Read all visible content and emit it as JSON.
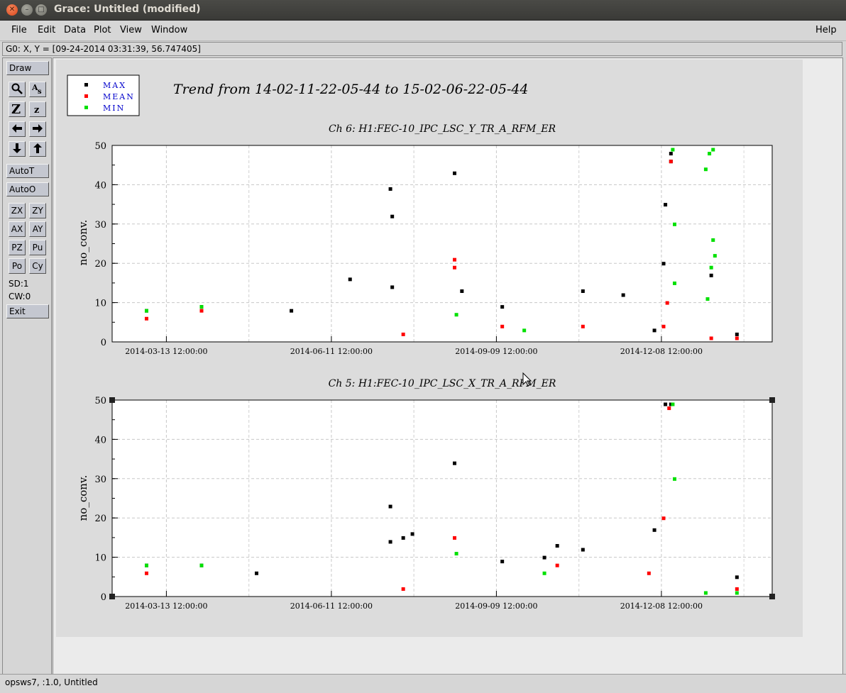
{
  "window": {
    "title": "Grace: Untitled (modified)"
  },
  "menus": {
    "file": "File",
    "edit": "Edit",
    "data": "Data",
    "plot": "Plot",
    "view": "View",
    "window": "Window",
    "help": "Help"
  },
  "locator": "G0: X, Y = [09-24-2014 03:31:39, 56.747405]",
  "toolbar": {
    "draw": "Draw",
    "autot": "AutoT",
    "autoo": "AutoO",
    "zx": "ZX",
    "zy": "ZY",
    "ax": "AX",
    "ay": "AY",
    "pz": "PZ",
    "pu": "Pu",
    "po": "Po",
    "cy": "Cy",
    "sd": "SD:1",
    "cw": "CW:0",
    "exit": "Exit"
  },
  "status": "opsws7, :1.0, Untitled",
  "colors": {
    "max": "#000000",
    "mean": "#ff0000",
    "min": "#00e000",
    "legend_text": "#0000cc"
  },
  "legend": [
    {
      "label": "MAX",
      "color": "#000000"
    },
    {
      "label": "MEAN",
      "color": "#ff0000"
    },
    {
      "label": "MIN",
      "color": "#00e000"
    }
  ],
  "title": "Trend from 14-02-11-22-05-44 to 15-02-06-22-05-44",
  "chart_data": [
    {
      "type": "scatter",
      "title": "Ch 6: H1:FEC-10_IPC_LSC_Y_TR_A_RFM_ER",
      "ylabel": "no_conv.",
      "xlabel": "",
      "xticks": [
        "2014-03-13 12:00:00",
        "2014-06-11 12:00:00",
        "2014-09-09 12:00:00",
        "2014-12-08 12:00:00"
      ],
      "ylim": [
        0,
        50
      ],
      "yticks": [
        0,
        10,
        20,
        30,
        40,
        50
      ],
      "grid": true,
      "series": [
        {
          "name": "MAX",
          "x": [
            "2014-03-02",
            "2014-04-01",
            "2014-05-20",
            "2014-06-21",
            "2014-07-13",
            "2014-07-14",
            "2014-07-14",
            "2014-08-17",
            "2014-08-21",
            "2014-09-12",
            "2014-10-26",
            "2014-11-17",
            "2014-12-04",
            "2014-12-09",
            "2014-12-10",
            "2014-12-13",
            "2014-12-13",
            "2015-01-04",
            "2015-01-18"
          ],
          "y": [
            8,
            9,
            8,
            16,
            39,
            32,
            14,
            43,
            13,
            9,
            13,
            12,
            3,
            20,
            35,
            48,
            46,
            17,
            2
          ]
        },
        {
          "name": "MEAN",
          "x": [
            "2014-03-02",
            "2014-04-01",
            "2014-07-20",
            "2014-08-17",
            "2014-08-17",
            "2014-09-12",
            "2014-10-26",
            "2014-12-09",
            "2014-12-11",
            "2014-12-13",
            "2015-01-04",
            "2015-01-18"
          ],
          "y": [
            6,
            8,
            2,
            21,
            19,
            4,
            4,
            4,
            10,
            46,
            1,
            1
          ]
        },
        {
          "name": "MIN",
          "x": [
            "2014-03-02",
            "2014-04-01",
            "2014-08-18",
            "2014-09-24",
            "2014-12-14",
            "2014-12-15",
            "2014-12-15",
            "2015-01-01",
            "2015-01-02",
            "2015-01-03",
            "2015-01-04",
            "2015-01-05",
            "2015-01-05",
            "2015-01-06"
          ],
          "y": [
            8,
            9,
            7,
            3,
            49,
            30,
            15,
            44,
            11,
            48,
            19,
            49,
            26,
            22
          ]
        }
      ]
    },
    {
      "type": "scatter",
      "title": "Ch 5: H1:FEC-10_IPC_LSC_X_TR_A_RFM_ER",
      "ylabel": "no_conv.",
      "xlabel": "",
      "xticks": [
        "2014-03-13 12:00:00",
        "2014-06-11 12:00:00",
        "2014-09-09 12:00:00",
        "2014-12-08 12:00:00"
      ],
      "ylim": [
        0,
        50
      ],
      "yticks": [
        0,
        10,
        20,
        30,
        40,
        50
      ],
      "grid": true,
      "series": [
        {
          "name": "MAX",
          "x": [
            "2014-03-02",
            "2014-04-01",
            "2014-05-01",
            "2014-07-13",
            "2014-07-13",
            "2014-07-20",
            "2014-07-25",
            "2014-08-17",
            "2014-09-12",
            "2014-10-05",
            "2014-10-12",
            "2014-10-26",
            "2014-12-04",
            "2014-12-10",
            "2014-12-13",
            "2015-01-18"
          ],
          "y": [
            8,
            8,
            6,
            23,
            14,
            15,
            16,
            34,
            9,
            10,
            13,
            12,
            17,
            49,
            49,
            5
          ]
        },
        {
          "name": "MEAN",
          "x": [
            "2014-03-02",
            "2014-07-20",
            "2014-08-17",
            "2014-10-12",
            "2014-12-01",
            "2014-12-09",
            "2014-12-12",
            "2015-01-18"
          ],
          "y": [
            6,
            2,
            15,
            8,
            6,
            20,
            48,
            2
          ]
        },
        {
          "name": "MIN",
          "x": [
            "2014-03-02",
            "2014-04-01",
            "2014-08-18",
            "2014-10-05",
            "2014-12-14",
            "2014-12-15",
            "2015-01-01",
            "2015-01-18"
          ],
          "y": [
            8,
            8,
            11,
            6,
            49,
            30,
            1,
            1
          ]
        }
      ]
    }
  ]
}
